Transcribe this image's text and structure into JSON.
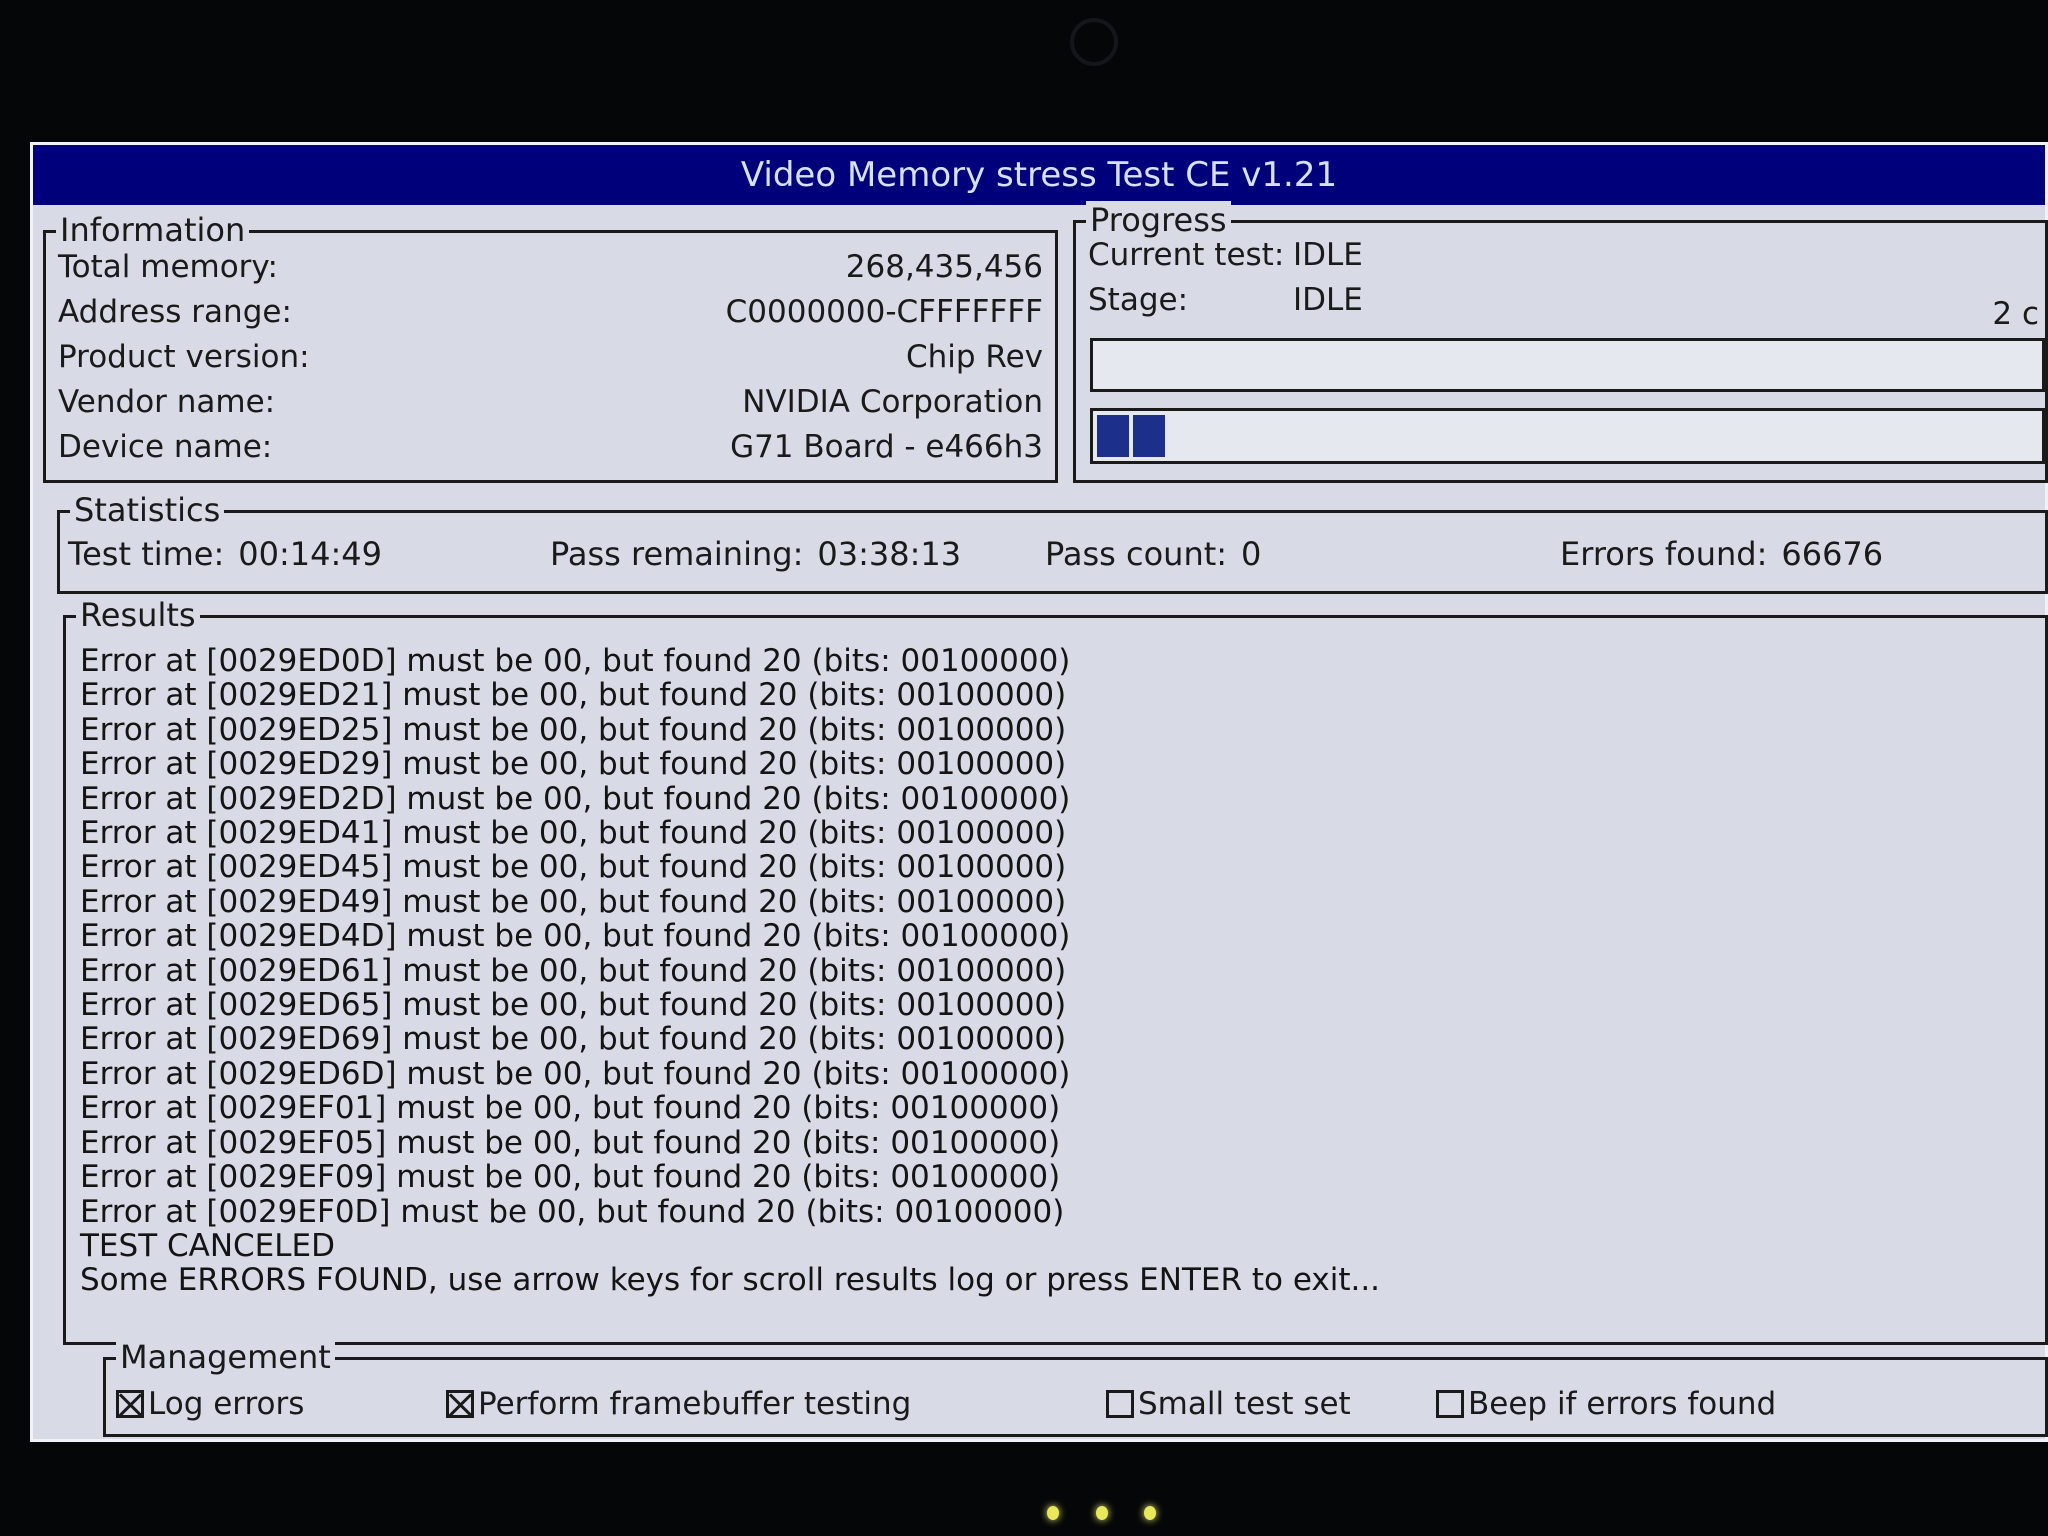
{
  "window": {
    "title": "Video Memory stress Test CE v1.21"
  },
  "information": {
    "label": "Information",
    "rows": [
      {
        "label": "Total memory:",
        "value": "268,435,456"
      },
      {
        "label": "Address range:",
        "value": "C0000000-CFFFFFFF"
      },
      {
        "label": "Product version:",
        "value": "Chip Rev"
      },
      {
        "label": "Vendor name:",
        "value": "NVIDIA Corporation"
      },
      {
        "label": "Device name:",
        "value": "G71 Board - e466h3"
      }
    ]
  },
  "progress": {
    "label": "Progress",
    "current_test_label": "Current test:",
    "current_test_value": "IDLE",
    "stage_label": "Stage:",
    "stage_value": "IDLE",
    "right_text": "2 c",
    "bar_fill_color": "#1c2f8a"
  },
  "statistics": {
    "label": "Statistics",
    "test_time_label": "Test time:",
    "test_time_value": "00:14:49",
    "pass_remaining_label": "Pass remaining:",
    "pass_remaining_value": "03:38:13",
    "pass_count_label": "Pass count:",
    "pass_count_value": "0",
    "errors_found_label": "Errors found:",
    "errors_found_value": "66676"
  },
  "results": {
    "label": "Results",
    "lines": [
      "Error at [0029ED0D] must be 00, but found 20 (bits: 00100000)",
      "Error at [0029ED21] must be 00, but found 20 (bits: 00100000)",
      "Error at [0029ED25] must be 00, but found 20 (bits: 00100000)",
      "Error at [0029ED29] must be 00, but found 20 (bits: 00100000)",
      "Error at [0029ED2D] must be 00, but found 20 (bits: 00100000)",
      "Error at [0029ED41] must be 00, but found 20 (bits: 00100000)",
      "Error at [0029ED45] must be 00, but found 20 (bits: 00100000)",
      "Error at [0029ED49] must be 00, but found 20 (bits: 00100000)",
      "Error at [0029ED4D] must be 00, but found 20 (bits: 00100000)",
      "Error at [0029ED61] must be 00, but found 20 (bits: 00100000)",
      "Error at [0029ED65] must be 00, but found 20 (bits: 00100000)",
      "Error at [0029ED69] must be 00, but found 20 (bits: 00100000)",
      "Error at [0029ED6D] must be 00, but found 20 (bits: 00100000)",
      "Error at [0029EF01] must be 00, but found 20 (bits: 00100000)",
      "Error at [0029EF05] must be 00, but found 20 (bits: 00100000)",
      "Error at [0029EF09] must be 00, but found 20 (bits: 00100000)",
      "Error at [0029EF0D] must be 00, but found 20 (bits: 00100000)",
      "TEST CANCELED",
      "Some ERRORS FOUND, use arrow keys for scroll results log or press ENTER to exit..."
    ]
  },
  "management": {
    "label": "Management",
    "options": [
      {
        "label": "Log errors",
        "checked": true
      },
      {
        "label": "Perform framebuffer testing",
        "checked": true
      },
      {
        "label": "Small test set",
        "checked": false
      },
      {
        "label": "Beep if errors found",
        "checked": false
      }
    ]
  }
}
